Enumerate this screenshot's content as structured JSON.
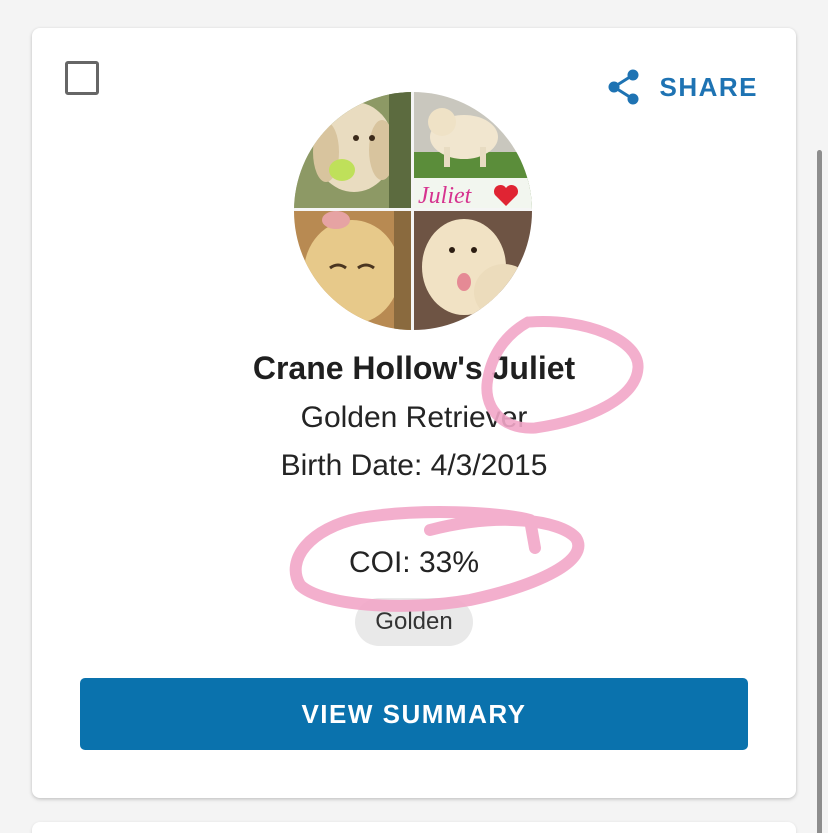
{
  "card": {
    "share_label": "SHARE",
    "avatar_caption": "Juliet",
    "dog_name": "Crane Hollow's Juliet",
    "breed": "Golden Retriever",
    "birth_date_label": "Birth Date:",
    "birth_date": "4/3/2015",
    "coi_label": "COI:",
    "coi_value": "33%",
    "tag": "Golden",
    "view_summary_label": "VIEW SUMMARY",
    "checkbox_checked": false
  },
  "icons": {
    "share": "share-icon",
    "heart": "heart-emoji"
  },
  "colors": {
    "accent": "#1e73b3",
    "button": "#0a72ad",
    "annotation": "#f2a6c8",
    "caption": "#d6338f"
  }
}
